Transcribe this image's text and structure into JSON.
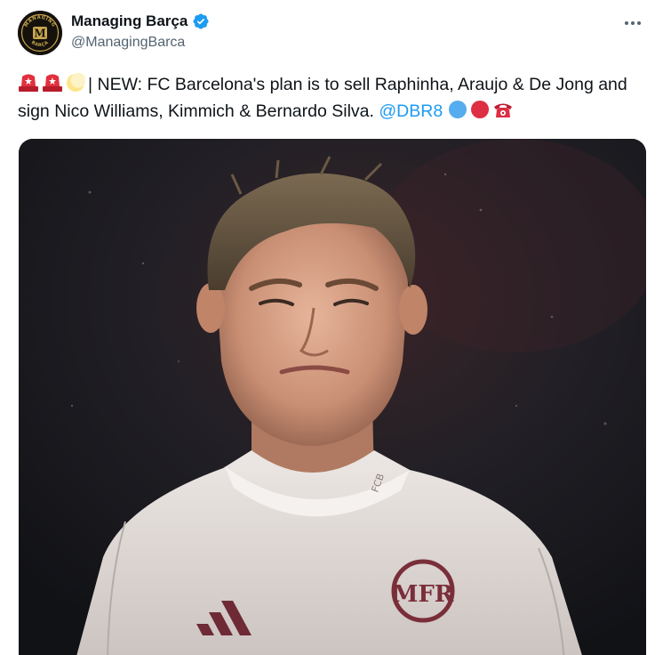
{
  "author": {
    "display_name": "Managing Barça",
    "handle": "@ManagingBarca",
    "avatar_text_top": "MANAGING",
    "avatar_text_bottom": "BARÇA",
    "avatar_monogram": "M",
    "verified": true
  },
  "tweet": {
    "emojis_lead": [
      "police-car-light",
      "police-car-light",
      "crescent-moon"
    ],
    "text_main": "| NEW: FC Barcelona's plan is to sell Raphinha, Araujo & De Jong and sign Nico Williams, Kimmich & Bernardo Silva.",
    "mention": "@DBR8",
    "emojis_tail": [
      "blue-circle",
      "red-circle",
      "telephone"
    ]
  },
  "media": {
    "shirt_text": "FCB",
    "crest_letters": "MFR"
  },
  "colors": {
    "accent": "#1d9bf0",
    "text": "#0f1419",
    "muted": "#536471",
    "crest": "#7a2e3a"
  }
}
